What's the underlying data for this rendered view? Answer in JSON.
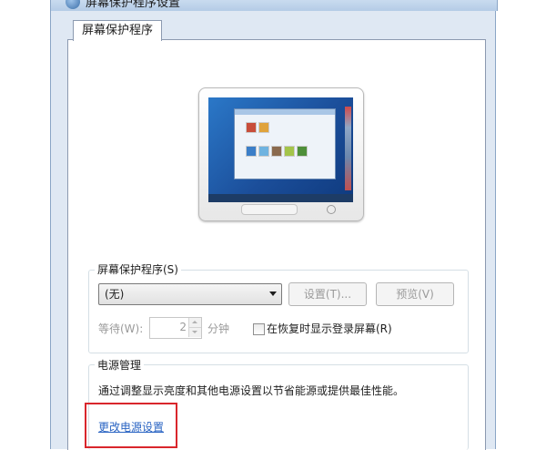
{
  "window": {
    "title": "屏幕保护程序设置"
  },
  "tabs": [
    {
      "label": "屏幕保护程序"
    }
  ],
  "screensaver_group": {
    "legend": "屏幕保护程序(S)",
    "dropdown_value": "(无)",
    "settings_button": "设置(T)...",
    "preview_button": "预览(V)",
    "wait_label": "等待(W):",
    "wait_value": "2",
    "minutes_label": "分钟",
    "resume_checkbox_label": "在恢复时显示登录屏幕(R)",
    "resume_checked": false
  },
  "power_group": {
    "legend": "电源管理",
    "description": "通过调整显示亮度和其他电源设置以节省能源或提供最佳性能。",
    "link": "更改电源设置"
  },
  "colors": {
    "highlight": "#d9262c",
    "link": "#2a64c3",
    "disabled_text": "#9a9a9a"
  }
}
